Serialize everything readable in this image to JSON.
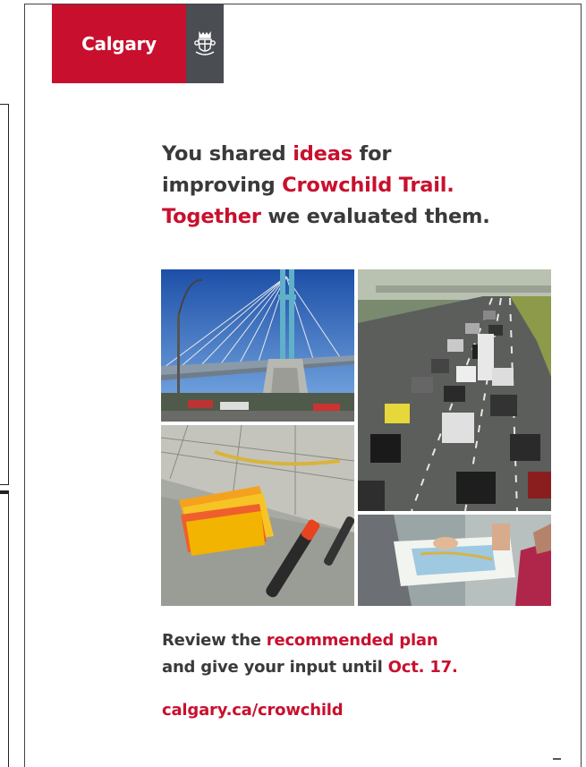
{
  "logo": {
    "wordmark": "Calgary",
    "crest_icon": "city-crest-icon",
    "colors": {
      "red": "#c8102e",
      "gray": "#4a4d52"
    }
  },
  "headline": {
    "line1_a": "You shared ",
    "line1_b": "ideas",
    "line1_c": " for",
    "line2_a": "improving ",
    "line2_b": "Crowchild Trail.",
    "line3_a": "Together",
    "line3_b": " we evaluated them."
  },
  "photos": [
    "bridge-photo",
    "traffic-photo",
    "map-sticky-notes-photo",
    "people-reviewing-map-photo"
  ],
  "footer": {
    "line1_a": "Review the ",
    "line1_b": "recommended plan",
    "line2_a": "and give your input until ",
    "line2_b": "Oct. 17.",
    "url": "calgary.ca/crowchild"
  },
  "colors": {
    "accent": "#c8102e",
    "text": "#3a3a3a"
  }
}
